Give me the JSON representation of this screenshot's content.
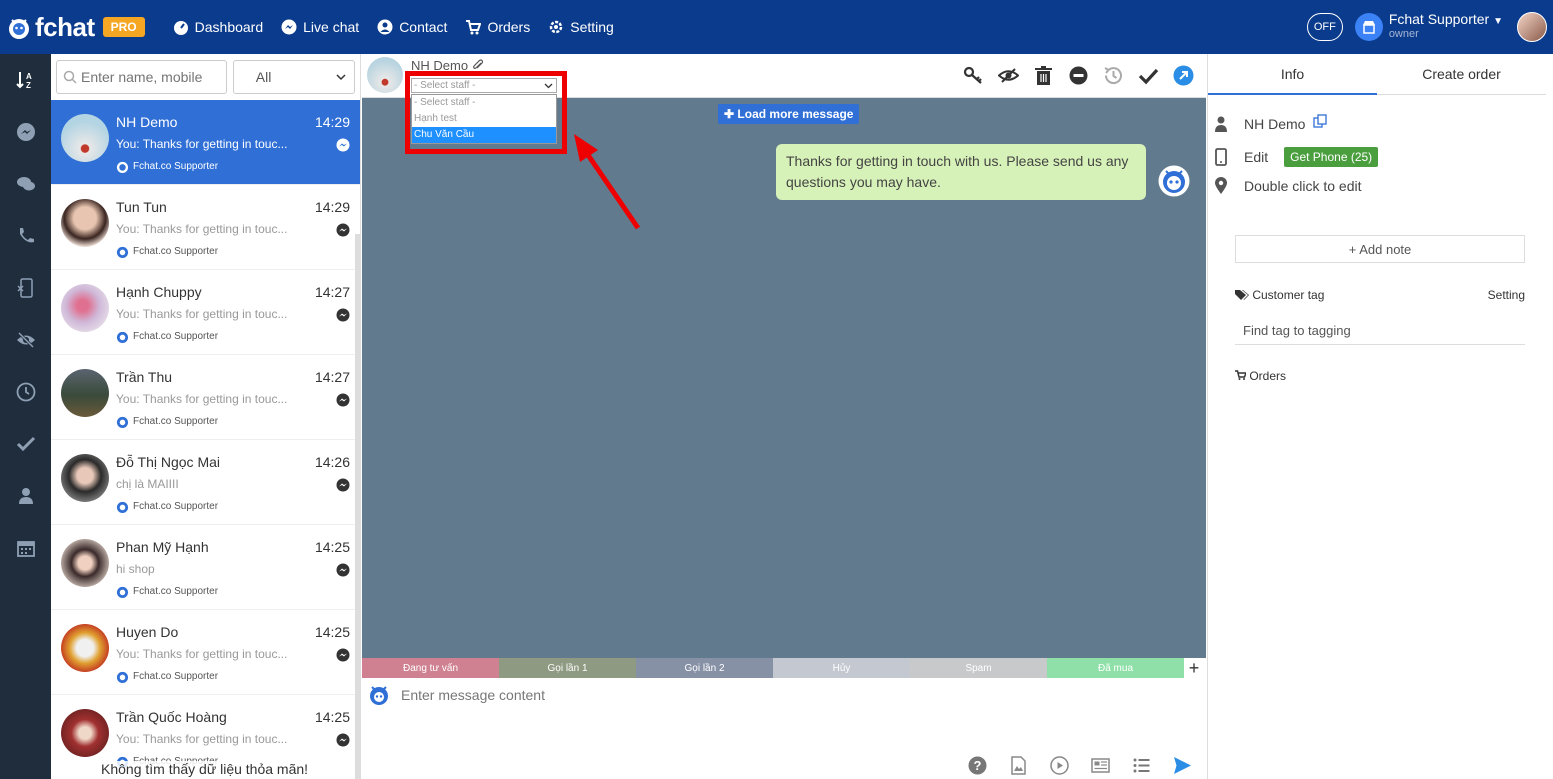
{
  "brand": {
    "name": "fchat",
    "badge": "PRO"
  },
  "nav": [
    {
      "label": "Dashboard",
      "icon": "dashboard-icon"
    },
    {
      "label": "Live chat",
      "icon": "messenger-icon"
    },
    {
      "label": "Contact",
      "icon": "user-circle-icon"
    },
    {
      "label": "Orders",
      "icon": "cart-icon"
    },
    {
      "label": "Setting",
      "icon": "gear-icon"
    }
  ],
  "topright": {
    "toggle": "OFF",
    "user_name": "Fchat Supporter",
    "user_role": "owner"
  },
  "list": {
    "search_placeholder": "Enter name, mobile",
    "filter": "All",
    "empty": "Không tìm thấy dữ liệu thỏa mãn!",
    "items": [
      {
        "name": "NH Demo",
        "time": "14:29",
        "msg": "You: Thanks for getting in touc...",
        "agent": "Fchat.co Supporter"
      },
      {
        "name": "Tun Tun",
        "time": "14:29",
        "msg": "You: Thanks for getting in touc...",
        "agent": "Fchat.co Supporter"
      },
      {
        "name": "Hạnh Chuppy",
        "time": "14:27",
        "msg": "You: Thanks for getting in touc...",
        "agent": "Fchat.co Supporter"
      },
      {
        "name": "Trần Thu",
        "time": "14:27",
        "msg": "You: Thanks for getting in touc...",
        "agent": "Fchat.co Supporter"
      },
      {
        "name": "Đỗ Thị Ngọc Mai",
        "time": "14:26",
        "msg": "chị là MAIIII",
        "agent": "Fchat.co Supporter"
      },
      {
        "name": "Phan Mỹ Hạnh",
        "time": "14:25",
        "msg": "hi shop",
        "agent": "Fchat.co Supporter"
      },
      {
        "name": "Huyen Do",
        "time": "14:25",
        "msg": "You: Thanks for getting in touc...",
        "agent": "Fchat.co Supporter"
      },
      {
        "name": "Trần Quốc Hoàng",
        "time": "14:25",
        "msg": "You: Thanks for getting in touc...",
        "agent": "Fchat.co Supporter"
      }
    ]
  },
  "chat": {
    "contact_name": "NH Demo",
    "staff_select": "- Select staff -",
    "staff_options": [
      "- Select staff -",
      "Hạnh test",
      "Chu Văn Cầu"
    ],
    "load_more": "Load more message",
    "message": "Thanks for getting in touch with us. Please send us any questions you may have.",
    "tags": [
      {
        "label": "Đang tư vấn",
        "color": "#d08191"
      },
      {
        "label": "Gọi lần 1",
        "color": "#8f9a82"
      },
      {
        "label": "Gọi lần 2",
        "color": "#8791a6"
      },
      {
        "label": "Hủy",
        "color": "#c4c8d0"
      },
      {
        "label": "Spam",
        "color": "#c8c9cb"
      },
      {
        "label": "Đã mua",
        "color": "#8fe0a8"
      }
    ],
    "tag_add": "+",
    "composer_placeholder": "Enter message content"
  },
  "info": {
    "tabs": [
      "Info",
      "Create order"
    ],
    "name": "NH Demo",
    "phone_edit": "Edit",
    "get_phone": "Get Phone (25)",
    "location": "Double click to edit",
    "add_note": "+ Add note",
    "customer_tag": "Customer tag",
    "setting": "Setting",
    "find_tag": "Find tag to tagging",
    "orders": "Orders"
  }
}
